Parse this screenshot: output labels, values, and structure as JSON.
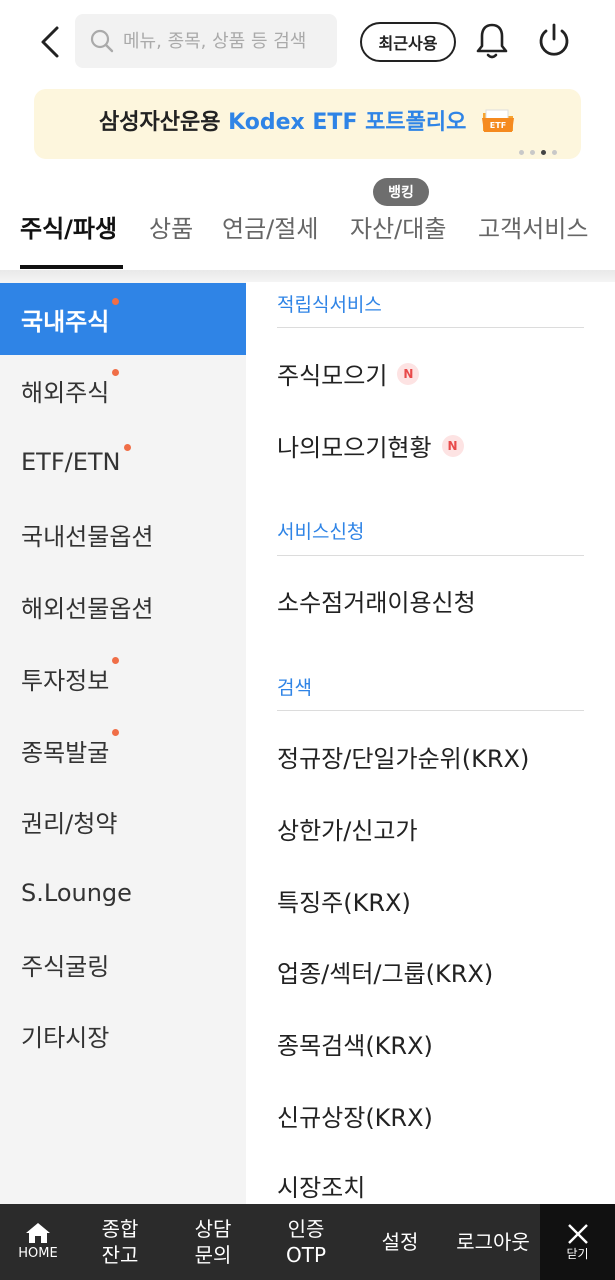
{
  "header": {
    "search_placeholder": "메뉴, 종목, 상품 등 검색",
    "recent_label": "최근사용"
  },
  "banner": {
    "text_part1": "삼성자산운용 ",
    "text_part2": "Kodex ETF 포트폴리오",
    "folder_label": "ETF",
    "page_count": 4,
    "active_page": 3
  },
  "tabs": {
    "bubble": "뱅킹",
    "items": [
      "주식/파생",
      "상품",
      "연금/절세",
      "자산/대출",
      "고객서비스"
    ]
  },
  "sidebar": {
    "items": [
      {
        "label": "국내주식",
        "dot": true,
        "active": true
      },
      {
        "label": "해외주식",
        "dot": true
      },
      {
        "label": "ETF/ETN",
        "dot": true
      },
      {
        "label": "국내선물옵션",
        "dot": false
      },
      {
        "label": "해외선물옵션",
        "dot": false
      },
      {
        "label": "투자정보",
        "dot": true
      },
      {
        "label": "종목발굴",
        "dot": true
      },
      {
        "label": "권리/청약",
        "dot": false
      },
      {
        "label": "S.Lounge",
        "dot": false
      },
      {
        "label": "주식굴링",
        "dot": false
      },
      {
        "label": "기타시장",
        "dot": false
      }
    ]
  },
  "content": {
    "sections": [
      {
        "title": "적립식서비스",
        "items": [
          {
            "label": "주식모으기",
            "badge": "N"
          },
          {
            "label": "나의모으기현황",
            "badge": "N"
          }
        ]
      },
      {
        "title": "서비스신청",
        "items": [
          {
            "label": "소수점거래이용신청"
          }
        ]
      },
      {
        "title": "검색",
        "items": [
          {
            "label": "정규장/단일가순위(KRX)"
          },
          {
            "label": "상한가/신고가"
          },
          {
            "label": "특징주(KRX)"
          },
          {
            "label": "업종/섹터/그룹(KRX)"
          },
          {
            "label": "종목검색(KRX)"
          },
          {
            "label": "신규상장(KRX)"
          },
          {
            "label": "시장조치"
          }
        ]
      }
    ]
  },
  "bottombar": {
    "home": "HOME",
    "balance": [
      "종합",
      "잔고"
    ],
    "consult": [
      "상담",
      "문의"
    ],
    "otp": [
      "인증",
      "OTP"
    ],
    "settings": "설정",
    "logout": "로그아웃",
    "close": "닫기"
  },
  "colors": {
    "accent": "#2f84e6",
    "badge_dot": "#f06e47",
    "banner_bg": "#fdf6dd",
    "bottom_bar": "#2b2b2b"
  }
}
